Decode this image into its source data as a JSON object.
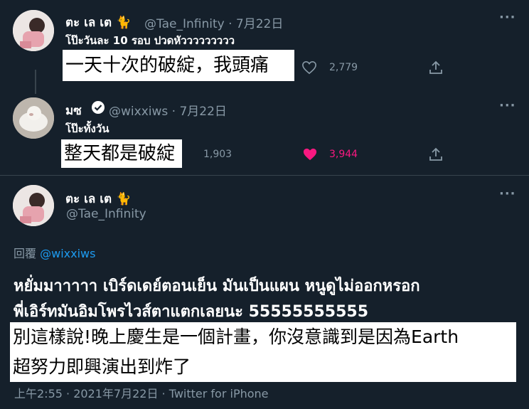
{
  "tweet1": {
    "display_name": "ตะ เล เต",
    "name_emoji": "🐈",
    "handle": "@Tae_Infinity",
    "date": "7月22日",
    "text": "โป๊ะวันละ 10 รอบ ปวดหัววววววววว",
    "translation": "一天十次的破綻，我頭痛",
    "like_count": "2,779"
  },
  "tweet2": {
    "display_name": "มซ",
    "handle": "@wixxiws",
    "date": "7月22日",
    "text": "โป๊ะทั้งวัน",
    "translation": "整天都是破綻",
    "retweet_count": "1,903",
    "like_count": "3,944"
  },
  "tweet3": {
    "display_name": "ตะ เล เต",
    "name_emoji": "🐈",
    "handle": "@Tae_Infinity",
    "reply_label": "回覆",
    "reply_handle": "@wixxiws",
    "text_line1": "หยั่มมาาาาา เบิร์ดเดย์ตอนเย็น มันเป็นแผน หนูดูไม่ออกหรอก",
    "text_line2": "พี่เอิร์ทมันอิมโพรไวส์ตาแตกเลยนะ 55555555555",
    "translation_line1": "別這樣說!晚上慶生是一個計畫，你沒意識到是因為Earth",
    "translation_line2": "超努力即興演出到炸了",
    "footer": "上午2:55 · 2021年7月22日 · Twitter for iPhone"
  },
  "colors": {
    "background": "#15202b",
    "accent": "#1d9bf0",
    "like": "#f91880",
    "muted": "#8899a6"
  }
}
